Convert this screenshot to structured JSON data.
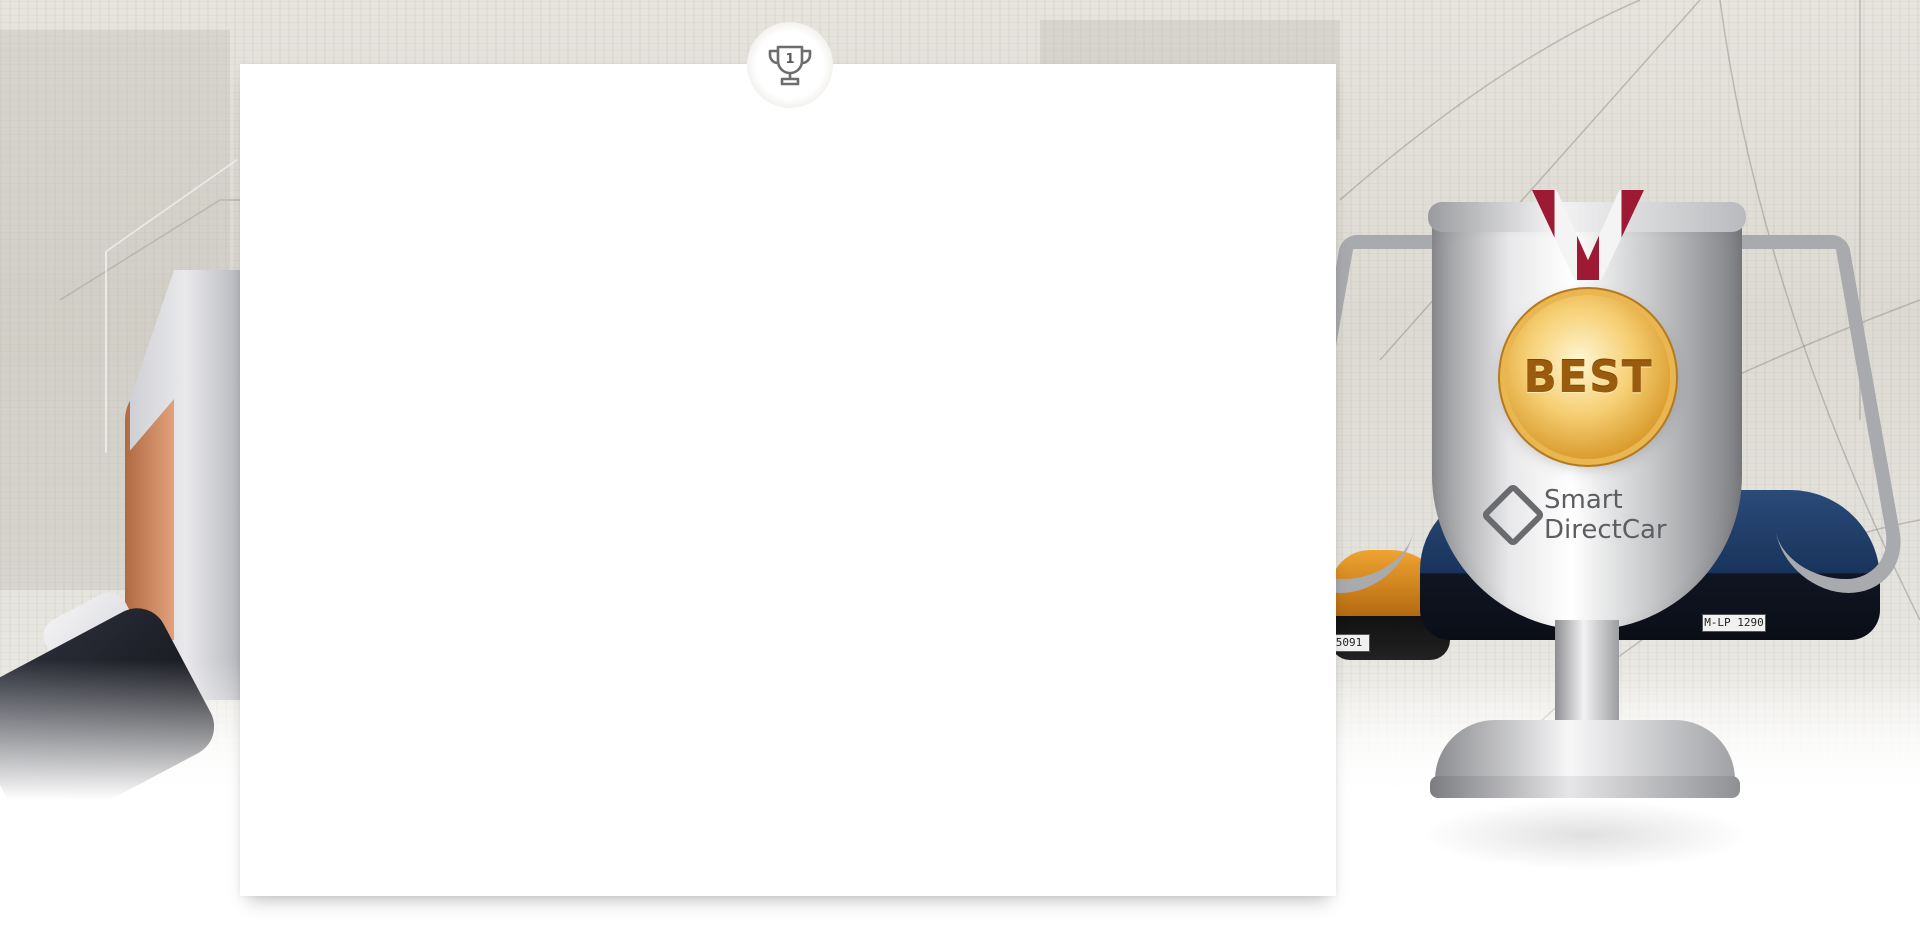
{
  "header_badge": {
    "icon": "trophy-icon",
    "number": "1"
  },
  "trophy": {
    "medal_text": "BEST",
    "brand_line1": "Smart",
    "brand_line2": "DirectCar"
  },
  "cars": {
    "plate_left": "5091",
    "plate_right": "M-LP 1290"
  },
  "colors": {
    "ribbon_red": "#9e1a34",
    "medal_gold": "#e9b650",
    "card_background": "#ffffff"
  }
}
